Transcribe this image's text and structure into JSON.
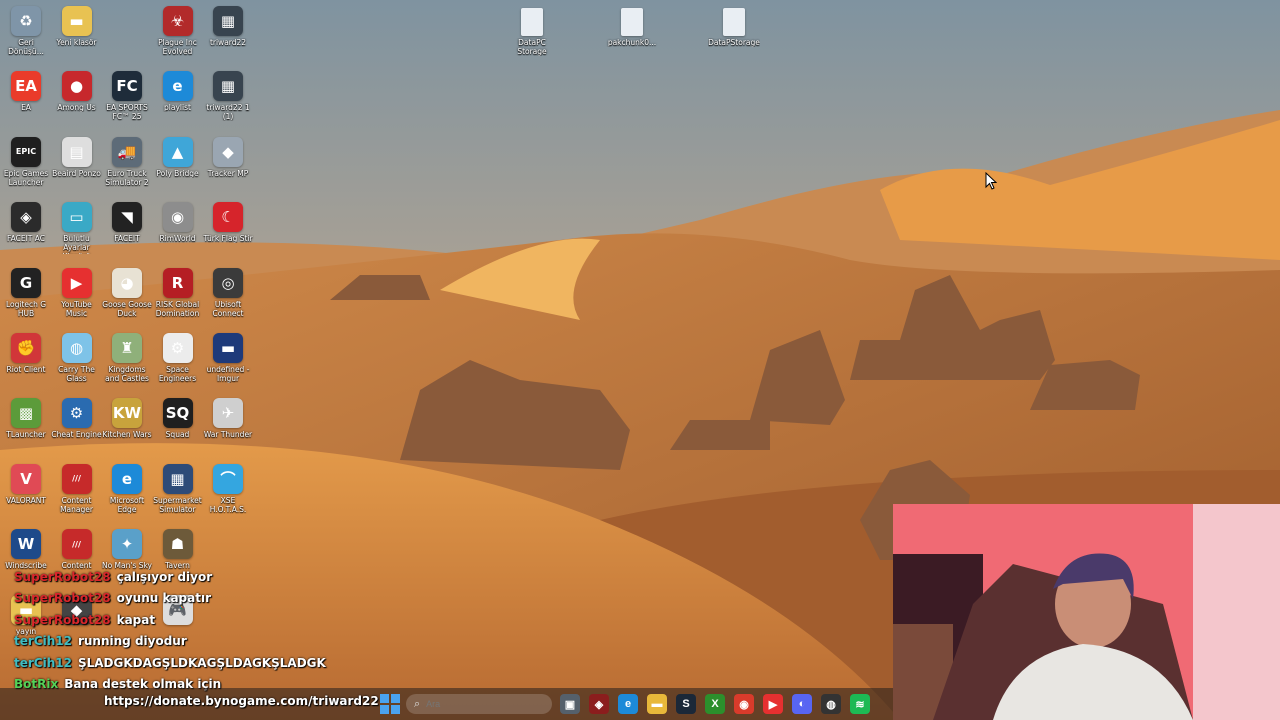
{
  "desktop": {
    "top_files": [
      {
        "label": "DataPC\nStorage",
        "icon": "file-icon"
      },
      {
        "label": "pakchunk0...",
        "icon": "file-icon"
      },
      {
        "label": "DataPStorage",
        "icon": "file-icon"
      }
    ],
    "icons": [
      {
        "label": "Geri Dönüşü...",
        "icon": "recycle-bin-icon",
        "color": "#7f95a8",
        "glyph": "♻",
        "col": 0,
        "row": 0
      },
      {
        "label": "Yeni klasör",
        "icon": "folder-icon",
        "color": "#e8c252",
        "glyph": "▬",
        "col": 1,
        "row": 0
      },
      {
        "label": "Plague Inc Evolved",
        "icon": "plague-inc-icon",
        "color": "#b22a2a",
        "glyph": "☣",
        "col": 3,
        "row": 0
      },
      {
        "label": "triward22",
        "icon": "video-file-icon",
        "color": "#38444f",
        "glyph": "▦",
        "col": 4,
        "row": 0
      },
      {
        "label": "EA",
        "icon": "ea-icon",
        "color": "#ea3b2a",
        "glyph": "EA",
        "col": 0,
        "row": 1
      },
      {
        "label": "Among Us",
        "icon": "among-us-icon",
        "color": "#c7282c",
        "glyph": "●",
        "col": 1,
        "row": 1
      },
      {
        "label": "EA SPORTS FC™ 25",
        "icon": "ea-fc-icon",
        "color": "#1e2c3a",
        "glyph": "FC",
        "col": 2,
        "row": 1
      },
      {
        "label": "playlist",
        "icon": "edge-icon",
        "color": "#1d8ad8",
        "glyph": "e",
        "col": 3,
        "row": 1
      },
      {
        "label": "triward22 1 (1)",
        "icon": "video-file-icon",
        "color": "#38444f",
        "glyph": "▦",
        "col": 4,
        "row": 1
      },
      {
        "label": "Epic Games Launcher",
        "icon": "epic-games-icon",
        "color": "#1f1f1f",
        "glyph": "EPIC",
        "col": 0,
        "row": 2
      },
      {
        "label": "Beaird Ponzo",
        "icon": "doc-icon",
        "color": "#dedede",
        "glyph": "▤",
        "col": 1,
        "row": 2
      },
      {
        "label": "Euro Truck Simulator 2",
        "icon": "euro-truck-icon",
        "color": "#5d6b78",
        "glyph": "🚚",
        "col": 2,
        "row": 2
      },
      {
        "label": "Poly Bridge",
        "icon": "poly-bridge-icon",
        "color": "#3fa6d8",
        "glyph": "▲",
        "col": 3,
        "row": 2
      },
      {
        "label": "Tracker MP",
        "icon": "tracker-icon",
        "color": "#9aa6b2",
        "glyph": "◆",
        "col": 4,
        "row": 2
      },
      {
        "label": "FACEIT AC",
        "icon": "faceit-ac-icon",
        "color": "#2b2b2b",
        "glyph": "◈",
        "col": 0,
        "row": 3
      },
      {
        "label": "Bulutlu Ayarlar Klasörü",
        "icon": "monitor-icon",
        "color": "#3aa9c6",
        "glyph": "▭",
        "col": 1,
        "row": 3
      },
      {
        "label": "FACEIT",
        "icon": "faceit-icon",
        "color": "#222",
        "glyph": "◥",
        "col": 2,
        "row": 3
      },
      {
        "label": "RimWorld",
        "icon": "rimworld-icon",
        "color": "#8d8d8d",
        "glyph": "◉",
        "col": 3,
        "row": 3
      },
      {
        "label": "Türk Flag Stir",
        "icon": "turkish-flag-icon",
        "color": "#d6242b",
        "glyph": "☾",
        "col": 4,
        "row": 3
      },
      {
        "label": "Logitech G HUB",
        "icon": "logitech-icon",
        "color": "#222",
        "glyph": "G",
        "col": 0,
        "row": 4
      },
      {
        "label": "YouTube Music",
        "icon": "youtube-music-icon",
        "color": "#e63030",
        "glyph": "▶",
        "col": 1,
        "row": 4
      },
      {
        "label": "Goose Goose Duck",
        "icon": "goose-icon",
        "color": "#e8e2d4",
        "glyph": "◕",
        "col": 2,
        "row": 4
      },
      {
        "label": "RISK Global Domination",
        "icon": "risk-icon",
        "color": "#b51e24",
        "glyph": "R",
        "col": 3,
        "row": 4
      },
      {
        "label": "Ubisoft Connect",
        "icon": "ubisoft-icon",
        "color": "#3b3b3b",
        "glyph": "◎",
        "col": 4,
        "row": 4
      },
      {
        "label": "Riot Client",
        "icon": "riot-icon",
        "color": "#d13639",
        "glyph": "✊",
        "col": 0,
        "row": 5
      },
      {
        "label": "Carry The Glass",
        "icon": "carry-glass-icon",
        "color": "#7ec3e8",
        "glyph": "◍",
        "col": 1,
        "row": 5
      },
      {
        "label": "Kingdoms and Castles",
        "icon": "kingdoms-icon",
        "color": "#8fb07a",
        "glyph": "♜",
        "col": 2,
        "row": 5
      },
      {
        "label": "Space Engineers",
        "icon": "space-engineers-icon",
        "color": "#ececec",
        "glyph": "⚙",
        "col": 3,
        "row": 5
      },
      {
        "label": "undefined - Imgur",
        "icon": "imgur-icon",
        "color": "#1e3a7a",
        "glyph": "▬",
        "col": 4,
        "row": 5
      },
      {
        "label": "TLauncher",
        "icon": "tlauncher-icon",
        "color": "#5c9b3a",
        "glyph": "▩",
        "col": 0,
        "row": 6
      },
      {
        "label": "Cheat Engine",
        "icon": "cheat-engine-icon",
        "color": "#2a6bb0",
        "glyph": "⚙",
        "col": 1,
        "row": 6
      },
      {
        "label": "Kitchen Wars",
        "icon": "kitchen-wars-icon",
        "color": "#c8a33c",
        "glyph": "KW",
        "col": 2,
        "row": 6
      },
      {
        "label": "Squad",
        "icon": "squad-icon",
        "color": "#1f1f1f",
        "glyph": "SQ",
        "col": 3,
        "row": 6
      },
      {
        "label": "War Thunder",
        "icon": "war-thunder-icon",
        "color": "#cfcfcf",
        "glyph": "✈",
        "col": 4,
        "row": 6
      },
      {
        "label": "VALORANT",
        "icon": "valorant-icon",
        "color": "#e04a55",
        "glyph": "V",
        "col": 0,
        "row": 7
      },
      {
        "label": "Content Manager",
        "icon": "content-manager-icon",
        "color": "#c62a2a",
        "glyph": "///",
        "col": 1,
        "row": 7
      },
      {
        "label": "Microsoft Edge",
        "icon": "edge-icon",
        "color": "#1d8ad8",
        "glyph": "e",
        "col": 2,
        "row": 7
      },
      {
        "label": "Supermarket Simulator",
        "icon": "supermarket-icon",
        "color": "#2d4b78",
        "glyph": "▦",
        "col": 3,
        "row": 7
      },
      {
        "label": "XSE H.O.T.A.S.",
        "icon": "hotas-icon",
        "color": "#34a6e0",
        "glyph": "⌒",
        "col": 4,
        "row": 7
      },
      {
        "label": "Windscribe",
        "icon": "windscribe-icon",
        "color": "#1e4a8a",
        "glyph": "W",
        "col": 0,
        "row": 8
      },
      {
        "label": "Content",
        "icon": "content-icon",
        "color": "#c62a2a",
        "glyph": "///",
        "col": 1,
        "row": 8
      },
      {
        "label": "No Man's Sky",
        "icon": "no-mans-sky-icon",
        "color": "#5aa0c9",
        "glyph": "✦",
        "col": 2,
        "row": 8
      },
      {
        "label": "Tavern",
        "icon": "tavern-icon",
        "color": "#6d5a3a",
        "glyph": "☗",
        "col": 3,
        "row": 8
      },
      {
        "label": "yayın",
        "icon": "folder-icon",
        "color": "#e8c252",
        "glyph": "▬",
        "col": 0,
        "row": 9
      },
      {
        "label": "",
        "icon": "game-icon",
        "color": "#444",
        "glyph": "◆",
        "col": 1,
        "row": 9
      },
      {
        "label": "",
        "icon": "gamepad-icon",
        "color": "#ddd",
        "glyph": "🎮",
        "col": 3,
        "row": 9
      }
    ]
  },
  "chat": {
    "messages": [
      {
        "user": "SuperRobot28",
        "user_color": "#d9262b",
        "text": "çalışıyor diyor"
      },
      {
        "user": "SuperRobot28",
        "user_color": "#d9262b",
        "text": "oyunu kapatır"
      },
      {
        "user": "SuperRobot28",
        "user_color": "#d9262b",
        "text": "kapat"
      },
      {
        "user": "terCih12",
        "user_color": "#3fbcc2",
        "text": "running diyodur"
      },
      {
        "user": "terCih12",
        "user_color": "#3fbcc2",
        "text": "ŞLADGKDAGŞLDKAGŞLDAGKŞLADGK"
      },
      {
        "user": "BotRix",
        "user_color": "#53d158",
        "text": "Bana destek olmak için"
      }
    ],
    "donate_text": "https://donate.bynogame.com/triward22"
  },
  "taskbar": {
    "search_placeholder": "Ara",
    "apps": [
      {
        "icon": "task-view-icon",
        "color": "#55606b",
        "glyph": "▣"
      },
      {
        "icon": "shield-app-icon",
        "color": "#8b1d1d",
        "glyph": "◈"
      },
      {
        "icon": "edge-icon",
        "color": "#1d8ad8",
        "glyph": "e"
      },
      {
        "icon": "file-explorer-icon",
        "color": "#e8b83a",
        "glyph": "▬"
      },
      {
        "icon": "steam-icon",
        "color": "#1b2838",
        "glyph": "S"
      },
      {
        "icon": "xbox-icon",
        "color": "#2c8f2c",
        "glyph": "X"
      },
      {
        "icon": "chrome-icon",
        "color": "#d93b2b",
        "glyph": "◉"
      },
      {
        "icon": "youtube-music-icon",
        "color": "#e63030",
        "glyph": "▶"
      },
      {
        "icon": "discord-icon",
        "color": "#5865f2",
        "glyph": "◐"
      },
      {
        "icon": "obs-icon",
        "color": "#333",
        "glyph": "◍"
      },
      {
        "icon": "spotify-icon",
        "color": "#1db954",
        "glyph": "≋"
      }
    ]
  }
}
